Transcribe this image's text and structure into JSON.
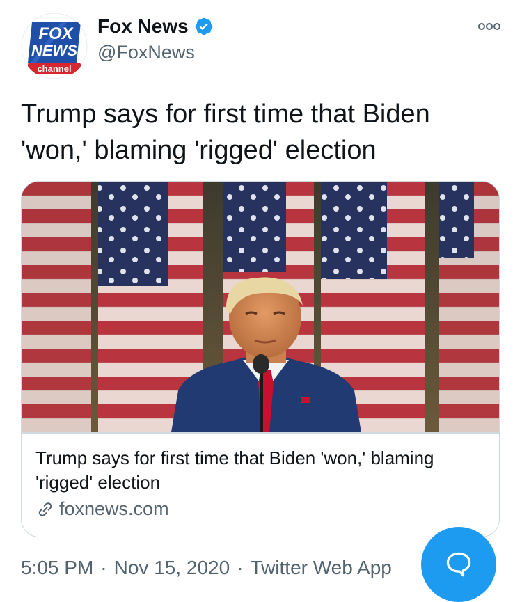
{
  "account": {
    "display_name": "Fox News",
    "handle": "@FoxNews",
    "verified": true,
    "avatar_logo": {
      "line1": "FOX",
      "line2": "NEWS",
      "line3": "channel"
    }
  },
  "tweet": {
    "text": "Trump says for first time that Biden 'won,' blaming 'rigged' election"
  },
  "card": {
    "image": "photo-trump-at-podium-with-flags",
    "title": "Trump says for first time that Biden 'won,' blaming 'rigged' election",
    "domain": "foxnews.com"
  },
  "meta": {
    "time": "5:05 PM",
    "date": "Nov 15, 2020",
    "source": "Twitter Web App",
    "separator": "·"
  },
  "icons": {
    "more": "more-horizontal-icon",
    "verified": "verified-badge-icon",
    "link": "link-icon",
    "compose": "speech-bubble-icon"
  },
  "colors": {
    "accent": "#1d9bf0",
    "secondary_text": "#536471",
    "border": "#cfd9de",
    "fox_blue": "#1f4fa8",
    "fox_red": "#d7262e"
  }
}
